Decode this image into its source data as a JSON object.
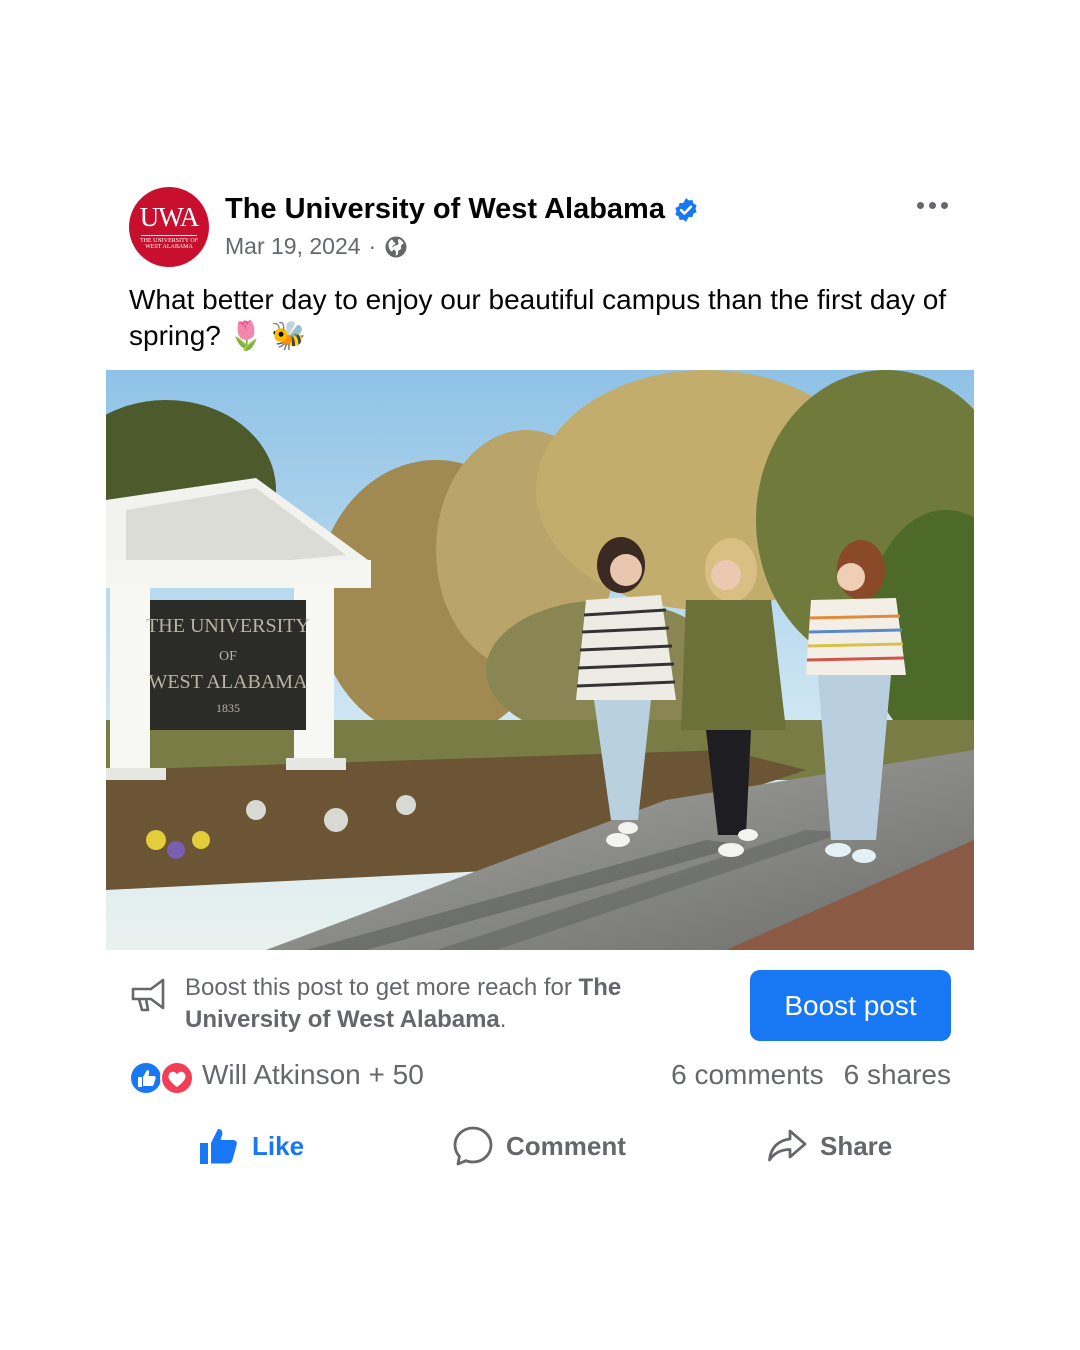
{
  "page": {
    "avatar_text": "UWA",
    "avatar_subtext": "The University of West Alabama",
    "name": "The University of West Alabama",
    "date": "Mar 19, 2024",
    "separator": "·"
  },
  "post": {
    "caption": "What better day to enjoy our beautiful campus than the first day of spring? 🌷 🐝",
    "photo_sign_line1": "THE UNIVERSITY",
    "photo_sign_line2": "OF",
    "photo_sign_line3": "WEST ALABAMA",
    "photo_sign_year": "1835"
  },
  "boost": {
    "text_prefix": "Boost this post to get more reach for ",
    "text_bold": "The University of West Alabama",
    "text_suffix": ".",
    "button_label": "Boost post"
  },
  "stats": {
    "reactors": "Will Atkinson + 50",
    "comments": "6 comments",
    "shares": "6 shares"
  },
  "actions": {
    "like": "Like",
    "comment": "Comment",
    "share": "Share"
  },
  "colors": {
    "brand_blue": "#1877f2",
    "uwa_red": "#c8102e",
    "secondary_text": "#65676b"
  }
}
